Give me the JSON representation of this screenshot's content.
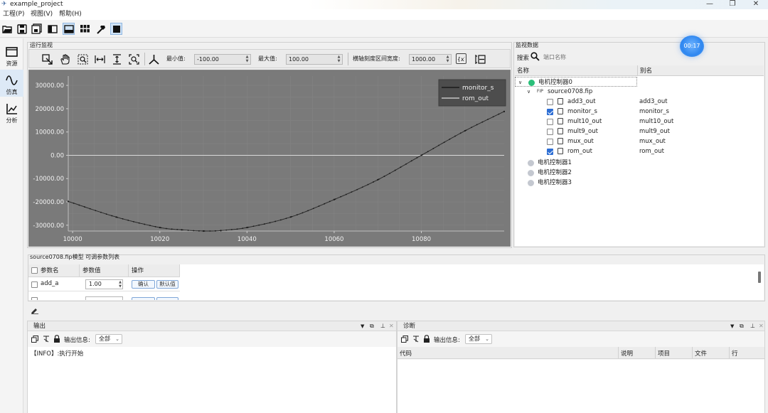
{
  "window": {
    "title": "example_project"
  },
  "menu": [
    "工程(P)",
    "视图(V)",
    "帮助(H)"
  ],
  "leftnav": [
    {
      "label": "资源",
      "icon": "folder-icon"
    },
    {
      "label": "仿真",
      "icon": "wave-icon"
    },
    {
      "label": "分析",
      "icon": "chart-icon"
    }
  ],
  "monitor": {
    "title": "运行监视",
    "min_label": "最小值:",
    "min_value": "-100.00",
    "max_label": "最大值:",
    "max_value": "100.00",
    "width_label": "横轴刻度区间宽度:",
    "width_value": "1000.00"
  },
  "chart_data": {
    "type": "line",
    "x_ticks": [
      "10000",
      "10020",
      "10040",
      "10060",
      "10080"
    ],
    "y_ticks": [
      "30000.00",
      "20000.00",
      "10000.00",
      "0.00",
      "-10000.00",
      "-20000.00",
      "-30000.00"
    ],
    "xlim": [
      9999,
      10099
    ],
    "ylim": [
      -32500,
      34000
    ],
    "grid": true,
    "legend_position": "top-right",
    "series": [
      {
        "name": "monitor_s",
        "x": [],
        "y": []
      },
      {
        "name": "rom_out",
        "x": [
          9999,
          10010,
          10020,
          10025,
          10030,
          10034,
          10040,
          10050,
          10060,
          10070,
          10080,
          10090,
          10099
        ],
        "y": [
          -19800,
          -26500,
          -31000,
          -32000,
          -32500,
          -32300,
          -31000,
          -26500,
          -19000,
          -10500,
          0,
          10500,
          18800
        ]
      }
    ]
  },
  "monitor_data": {
    "title": "监视数据",
    "search_label": "搜索",
    "search_placeholder": "端口名称",
    "col_name": "名称",
    "col_alias": "别名",
    "controller0": "电机控制器0",
    "file": "source0708.fip",
    "file_icon": "FIP",
    "signals": [
      {
        "name": "add3_out",
        "alias": "add3_out",
        "checked": false
      },
      {
        "name": "monitor_s",
        "alias": "monitor_s",
        "checked": true
      },
      {
        "name": "mult10_out",
        "alias": "mult10_out",
        "checked": false
      },
      {
        "name": "mult9_out",
        "alias": "mult9_out",
        "checked": false
      },
      {
        "name": "mux_out",
        "alias": "mux_out",
        "checked": false
      },
      {
        "name": "rom_out",
        "alias": "rom_out",
        "checked": true
      }
    ],
    "controllers": [
      "电机控制器1",
      "电机控制器2",
      "电机控制器3"
    ]
  },
  "timer": "00:17",
  "params": {
    "title": "source0708.fip模型 可调参数列表",
    "col_name": "参数名",
    "col_value": "参数值",
    "col_action": "操作",
    "rows": [
      {
        "name": "add_a",
        "value": "1.00",
        "confirm": "确认",
        "default": "默认值"
      }
    ]
  },
  "output": {
    "title": "输出",
    "info_label": "输出信息:",
    "filter": "全部",
    "log": "【INFO】:执行开始"
  },
  "diag": {
    "title": "诊断",
    "info_label": "输出信息:",
    "filter": "全部",
    "cols": [
      "代码",
      "说明",
      "项目",
      "文件",
      "行"
    ]
  },
  "colors": {
    "plot_bg": "#7a7a7a",
    "grid": "#8c8c8c",
    "accent": "#2d6ed4",
    "online": "#2bbf7a",
    "offline": "#c4c8d0"
  }
}
